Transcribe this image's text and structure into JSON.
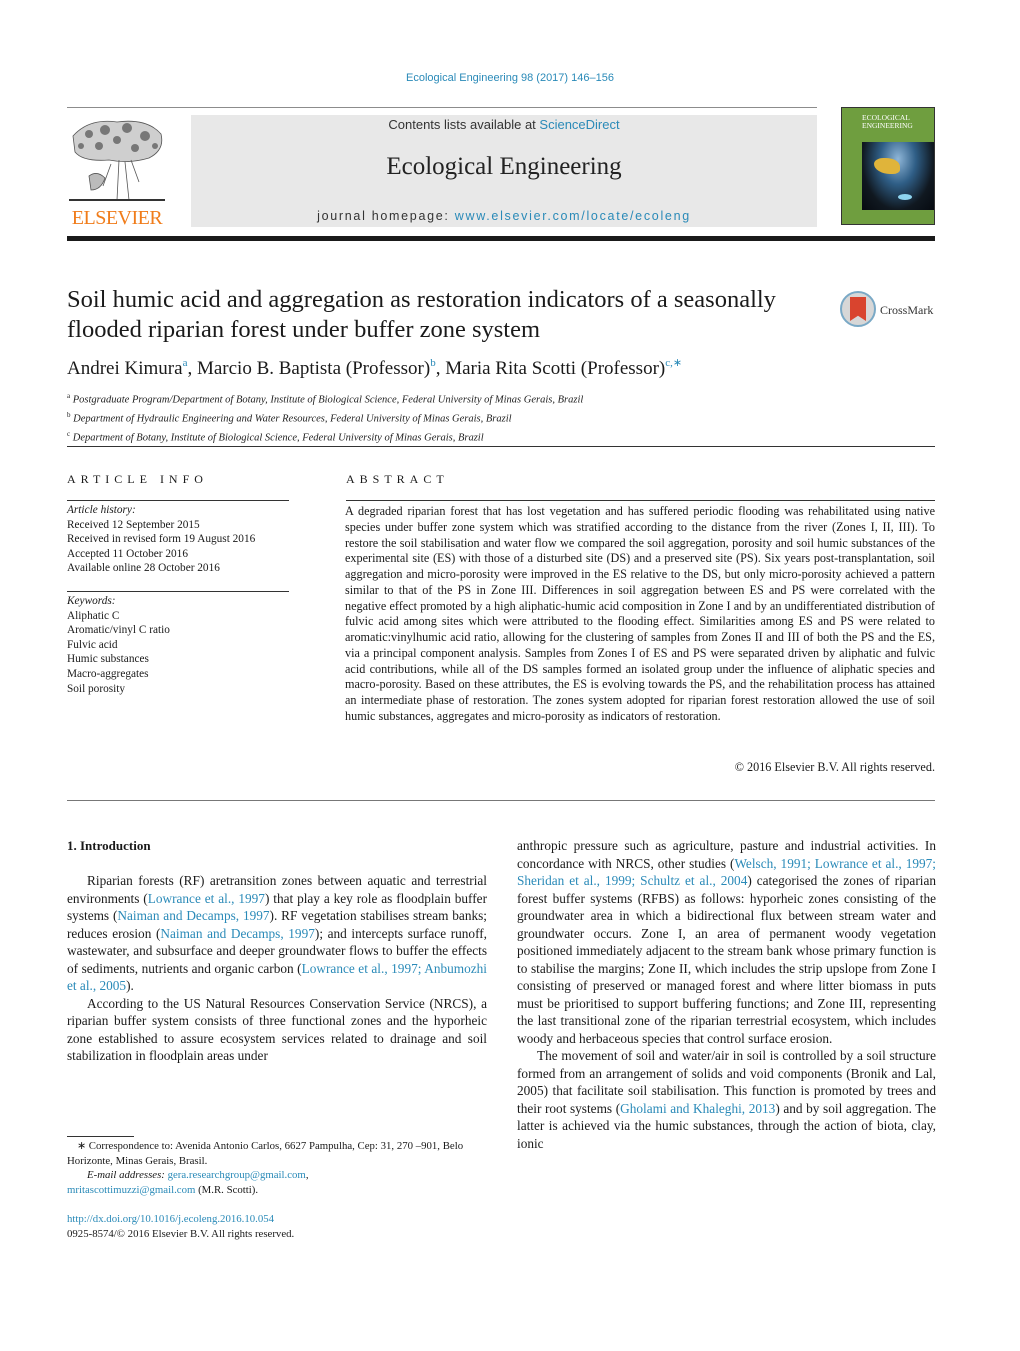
{
  "header": {
    "journal_reference": "Ecological Engineering 98 (2017) 146–156",
    "contents_prefix": "Contents lists available at ",
    "contents_link": "ScienceDirect",
    "journal_title": "Ecological Engineering",
    "homepage_prefix": "journal homepage: ",
    "homepage_url": "www.elsevier.com/locate/ecoleng",
    "publisher_logo_text": "ELSEVIER",
    "cover": {
      "title_line1": "ECOLOGICAL",
      "title_line2": "ENGINEERING"
    }
  },
  "article": {
    "title": "Soil humic acid and aggregation as restoration indicators of a seasonally flooded riparian forest under buffer zone system",
    "crossmark_label": "CrossMark",
    "authors": [
      {
        "name": "Andrei Kimura",
        "sup": "a"
      },
      {
        "name": "Marcio B. Baptista (Professor)",
        "sup": "b"
      },
      {
        "name": "Maria Rita Scotti (Professor)",
        "sup": "c,∗"
      }
    ],
    "affiliations": [
      {
        "sup": "a",
        "text": "Postgraduate Program/Department of Botany, Institute of Biological Science, Federal University of Minas Gerais, Brazil"
      },
      {
        "sup": "b",
        "text": "Department of Hydraulic Engineering and Water Resources, Federal University of Minas Gerais, Brazil"
      },
      {
        "sup": "c",
        "text": "Department of Botany, Institute of Biological Science, Federal University of Minas Gerais, Brazil"
      }
    ]
  },
  "article_info": {
    "heading": "ARTICLE INFO",
    "history_label": "Article history:",
    "history": [
      "Received 12 September 2015",
      "Received in revised form 19 August 2016",
      "Accepted 11 October 2016",
      "Available online 28 October 2016"
    ],
    "keywords_label": "Keywords:",
    "keywords": [
      "Aliphatic C",
      "Aromatic/vinyl C ratio",
      "Fulvic acid",
      "Humic substances",
      "Macro-aggregates",
      "Soil porosity"
    ]
  },
  "abstract": {
    "heading": "ABSTRACT",
    "text": "A degraded riparian forest that has lost vegetation and has suffered periodic flooding was rehabilitated using native species under buffer zone system which was stratified according to the distance from the river (Zones I, II, III). To restore the soil stabilisation and water flow we compared the soil aggregation, porosity and soil humic substances of the experimental site (ES) with those of a disturbed site (DS) and a preserved site (PS). Six years post-transplantation, soil aggregation and micro-porosity were improved in the ES relative to the DS, but only micro-porosity achieved a pattern similar to that of the PS in Zone III. Differences in soil aggregation between ES and PS were correlated with the negative effect promoted by a high aliphatic-humic acid composition in Zone I and by an undifferentiated distribution of fulvic acid among sites which were attributed to the flooding effect. Similarities among ES and PS were related to aromatic:vinylhumic acid ratio, allowing for the clustering of samples from Zones II and III of both the PS and the ES, via a principal component analysis. Samples from Zones I of ES and PS were separated driven by aliphatic and fulvic acid contributions, while all of the DS samples formed an isolated group under the influence of aliphatic species and macro-porosity. Based on these attributes, the ES is evolving towards the PS, and the rehabilitation process has attained an intermediate phase of restoration. The zones system adopted for riparian forest restoration allowed the use of soil humic substances, aggregates and micro-porosity as indicators of restoration.",
    "copyright": "© 2016 Elsevier B.V. All rights reserved."
  },
  "body": {
    "section_heading": "1.  Introduction",
    "left_p1": [
      {
        "t": "Riparian forests (RF) aretransition zones between aquatic and terrestrial environments ("
      },
      {
        "t": "Lowrance et al., 1997",
        "link": true
      },
      {
        "t": ") that play a key role as floodplain buffer systems ("
      },
      {
        "t": "Naiman and Decamps, 1997",
        "link": true
      },
      {
        "t": "). RF vegetation stabilises stream banks; reduces erosion ("
      },
      {
        "t": "Naiman and Decamps, 1997",
        "link": true
      },
      {
        "t": "); and intercepts surface runoff, wastewater, and subsurface and deeper groundwater flows to buffer the effects of sediments, nutrients and organic carbon ("
      },
      {
        "t": "Lowrance et al., 1997; Anbumozhi et al., 2005",
        "link": true
      },
      {
        "t": ")."
      }
    ],
    "left_p2": "According to the US Natural Resources Conservation Service (NRCS), a riparian buffer system consists of three functional zones and the hyporheic zone established to assure ecosystem services related to drainage and soil stabilization in floodplain areas under",
    "right_p1": [
      {
        "t": "anthropic pressure such as agriculture, pasture and industrial activities. In concordance with NRCS, other studies ("
      },
      {
        "t": "Welsch, 1991; Lowrance et al., 1997; Sheridan et al., 1999; Schultz et al., 2004",
        "link": true
      },
      {
        "t": ") categorised the zones of riparian forest buffer systems (RFBS) as follows: hyporheic zones consisting of the groundwater area in which a bidirectional flux between stream water and groundwater occurs. Zone I, an area of permanent woody vegetation positioned immediately adjacent to the stream bank whose primary function is to stabilise the margins; Zone II, which includes the strip upslope from Zone I consisting of preserved or managed forest and where litter biomass in puts must be prioritised to support buffering functions; and Zone III, representing the last transitional zone of the riparian terrestrial ecosystem, which includes woody and herbaceous species that control surface erosion."
      }
    ],
    "right_p2": [
      {
        "t": "The movement of soil and water/air in soil is controlled by a soil structure formed from an arrangement of solids and void components (Bronik and Lal, 2005) that facilitate soil stabilisation. This function is promoted by trees and their root systems ("
      },
      {
        "t": "Gholami and Khaleghi, 2013",
        "link": true
      },
      {
        "t": ") and by soil aggregation. The latter is achieved via the humic substances, through the action of biota, clay, ionic"
      }
    ]
  },
  "footnote": {
    "correspondence": "∗  Correspondence to: Avenida Antonio Carlos, 6627 Pampulha, Cep: 31, 270 –901, Belo Horizonte, Minas Gerais, Brasil.",
    "email_label": "E-mail addresses:",
    "email1": "gera.researchgroup@gmail.com",
    "email2": "mritascottimuzzi@gmail.com",
    "email2_suffix": " (M.R. Scotti).",
    "doi": "http://dx.doi.org/10.1016/j.ecoleng.2016.10.054",
    "issn_line": "0925-8574/© 2016 Elsevier B.V. All rights reserved."
  },
  "colors": {
    "link": "#2a8ab8",
    "elsevier_orange": "#f07c1a",
    "banner_gray": "#e8e8e8",
    "cover_green": "#6f9e3f"
  }
}
